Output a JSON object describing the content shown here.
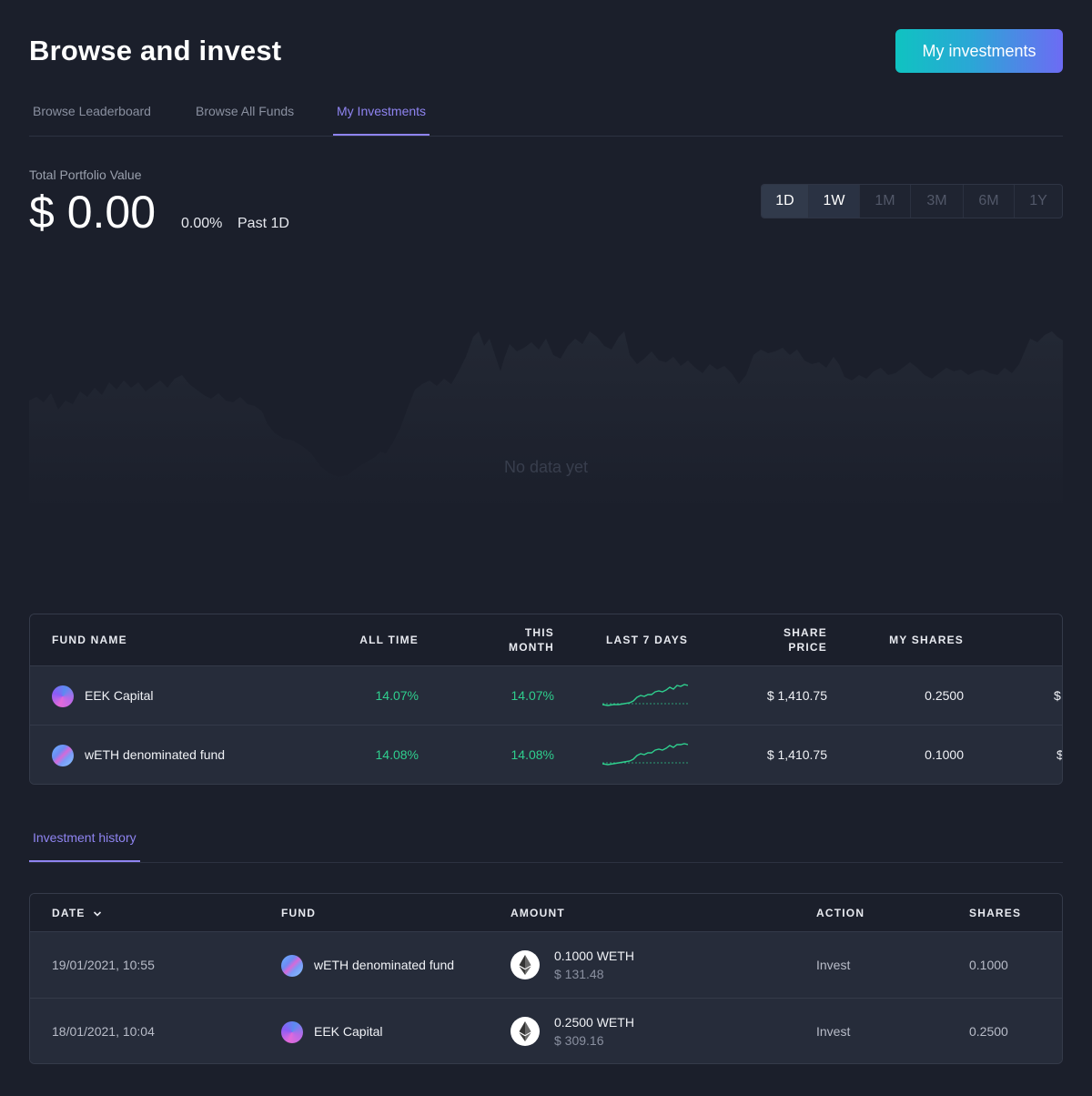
{
  "header": {
    "title": "Browse and invest",
    "cta_label": "My investments"
  },
  "tabs": [
    {
      "label": "Browse Leaderboard",
      "active": false
    },
    {
      "label": "Browse All Funds",
      "active": false
    },
    {
      "label": "My Investments",
      "active": true
    }
  ],
  "portfolio": {
    "label": "Total Portfolio Value",
    "value": "$ 0.00",
    "change": "0.00%",
    "period": "Past 1D",
    "ranges": [
      "1D",
      "1W",
      "1M",
      "3M",
      "6M",
      "1Y"
    ],
    "selected_ranges": [
      "1D",
      "1W"
    ],
    "empty_text": "No data yet"
  },
  "funds_table": {
    "headers": {
      "fund_name": "FUND NAME",
      "all_time": "ALL TIME",
      "this_month_1": "THIS",
      "this_month_2": "MONTH",
      "last_7_days": "LAST 7 DAYS",
      "share_price_1": "SHARE",
      "share_price_2": "PRICE",
      "my_shares": "MY SHARES"
    },
    "rows": [
      {
        "name": "EEK Capital",
        "icon": "eek-capital-avatar",
        "all_time": "14.07%",
        "this_month": "14.07%",
        "share_price": "$ 1,410.75",
        "my_shares": "0.2500",
        "value_clipped": "$"
      },
      {
        "name": "wETH denominated fund",
        "icon": "weth-fund-avatar",
        "all_time": "14.08%",
        "this_month": "14.08%",
        "share_price": "$ 1,410.75",
        "my_shares": "0.1000",
        "value_clipped": "$"
      }
    ]
  },
  "history": {
    "tab_label": "Investment history",
    "headers": {
      "date": "DATE",
      "fund": "FUND",
      "amount": "AMOUNT",
      "action": "ACTION",
      "shares": "SHARES"
    },
    "rows": [
      {
        "date": "19/01/2021, 10:55",
        "fund": "wETH denominated fund",
        "amount": "0.1000 WETH",
        "amount_usd": "$ 131.48",
        "action": "Invest",
        "shares": "0.1000"
      },
      {
        "date": "18/01/2021, 10:04",
        "fund": "EEK Capital",
        "amount": "0.2500 WETH",
        "amount_usd": "$ 309.16",
        "action": "Invest",
        "shares": "0.2500"
      }
    ]
  },
  "colors": {
    "background": "#1b1f2b",
    "accent": "#8f84f1",
    "positive": "#2fcf8e",
    "cta_gradient_start": "#0fc3c1",
    "cta_gradient_end": "#6d6bf4"
  }
}
